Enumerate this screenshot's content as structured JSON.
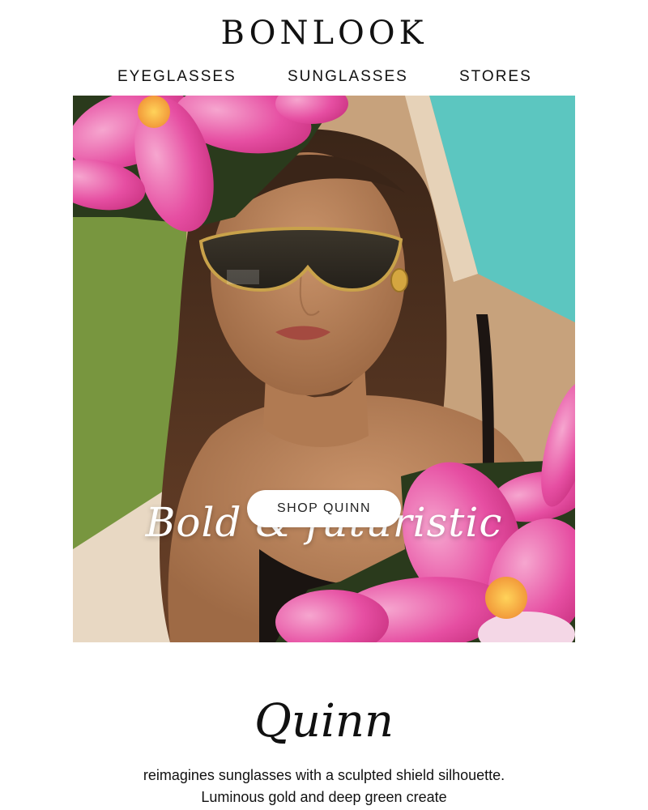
{
  "header": {
    "logo": "BONLOOK"
  },
  "nav": {
    "items": [
      {
        "label": "EYEGLASSES"
      },
      {
        "label": "SUNGLASSES"
      },
      {
        "label": "STORES"
      }
    ]
  },
  "hero": {
    "title": "Bold & futuristic",
    "cta_label": "SHOP QUINN",
    "image_alt": "woman wearing gold shield sunglasses by a pool with pink plumeria flowers"
  },
  "product": {
    "name": "Quinn",
    "description": "reimagines sunglasses with a sculpted shield silhouette. Luminous gold and deep green create"
  },
  "colors": {
    "flower_pink": "#e64ea2",
    "pool_teal": "#5cc6c0",
    "grass_green": "#6f8f3a",
    "lens_dark": "#2e2a22",
    "frame_gold": "#c9a24a"
  }
}
